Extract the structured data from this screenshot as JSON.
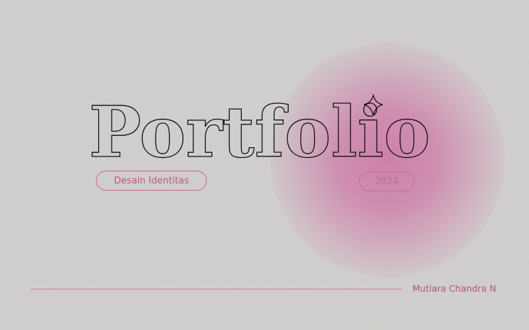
{
  "title": "Portfolio",
  "tag_left": "Desain Identitas",
  "tag_right": "2024",
  "author": "Mutiara Chandra N",
  "colors": {
    "background": "#d2d0cf",
    "accent": "#d076a6",
    "text_accent": "#b85a84",
    "outline": "#111111"
  },
  "icons": [
    "sparkle-icon"
  ]
}
